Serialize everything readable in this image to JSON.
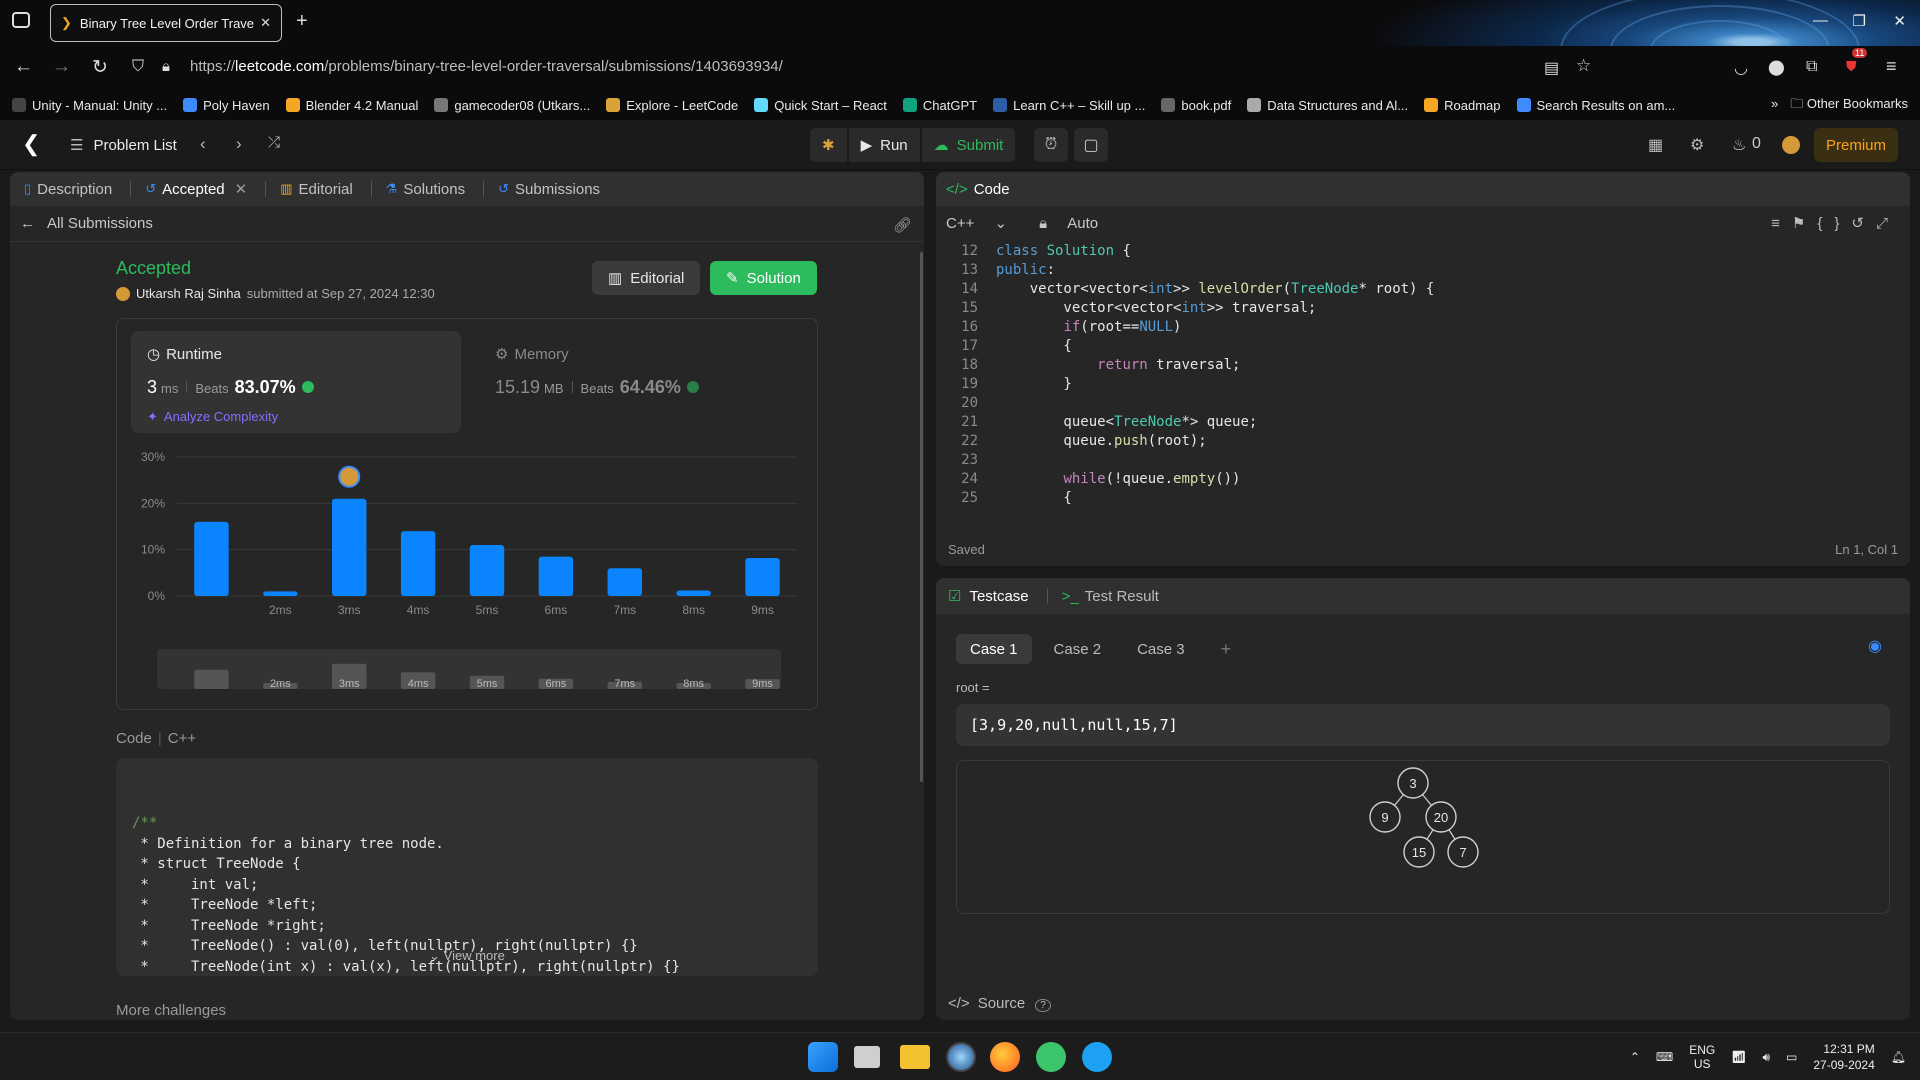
{
  "browser": {
    "tab_title": "Binary Tree Level Order Traver",
    "url_prefix": "https://",
    "url_domain": "leetcode.com",
    "url_path": "/problems/binary-tree-level-order-traversal/submissions/1403693934/",
    "bookmarks": [
      "Unity - Manual: Unity ...",
      "Poly Haven",
      "Blender 4.2 Manual",
      "gamecoder08 (Utkars...",
      "Explore - LeetCode",
      "Quick Start – React",
      "ChatGPT",
      "Learn C++ – Skill up ...",
      "book.pdf",
      "Data Structures and Al...",
      "Roadmap",
      "Search Results on am..."
    ],
    "other_bookmarks": "Other Bookmarks",
    "ext_badge": "11"
  },
  "topbar": {
    "problem_list": "Problem List",
    "run": "Run",
    "submit": "Submit",
    "streak": "0",
    "premium": "Premium"
  },
  "left": {
    "tabs": [
      "Description",
      "Accepted",
      "Editorial",
      "Solutions",
      "Submissions"
    ],
    "all_submissions": "All Submissions",
    "status": "Accepted",
    "author": "Utkarsh Raj Sinha",
    "submitted": "submitted at Sep 27, 2024 12:30",
    "editorial_btn": "Editorial",
    "solution_btn": "Solution",
    "runtime": {
      "label": "Runtime",
      "value": "3",
      "unit": "ms",
      "beats_label": "Beats",
      "beats": "83.07%"
    },
    "memory": {
      "label": "Memory",
      "value": "15.19",
      "unit": "MB",
      "beats_label": "Beats",
      "beats": "64.46%"
    },
    "analyze": "Analyze Complexity",
    "code_label": "Code",
    "code_lang": "C++",
    "code_lines": [
      "/**",
      " * Definition for a binary tree node.",
      " * struct TreeNode {",
      " *     int val;",
      " *     TreeNode *left;",
      " *     TreeNode *right;",
      " *     TreeNode() : val(0), left(nullptr), right(nullptr) {}",
      " *     TreeNode(int x) : val(x), left(nullptr), right(nullptr) {}"
    ],
    "view_more": "View more",
    "more_challenges": "More challenges"
  },
  "chart_data": {
    "type": "bar",
    "yticks": [
      "30%",
      "20%",
      "10%",
      "0%"
    ],
    "ylim": [
      0,
      30
    ],
    "categories": [
      "",
      "2ms",
      "3ms",
      "4ms",
      "5ms",
      "6ms",
      "7ms",
      "8ms",
      "9ms"
    ],
    "values": [
      16,
      1,
      21,
      14,
      11,
      8.5,
      6,
      1.2,
      8.2
    ],
    "highlight_index": 2,
    "colors": {
      "bar": "#0a84ff",
      "grid": "#3a3a3a"
    },
    "minimap_labels": [
      "2ms",
      "3ms",
      "4ms",
      "5ms",
      "6ms",
      "7ms",
      "8ms",
      "9ms"
    ]
  },
  "code": {
    "header": "Code",
    "lang": "C++",
    "mode": "Auto",
    "saved": "Saved",
    "cursor": "Ln 1, Col 1",
    "lines": [
      {
        "n": "12",
        "t": "class Solution {"
      },
      {
        "n": "13",
        "t": "public:"
      },
      {
        "n": "14",
        "t": "    vector<vector<int>> levelOrder(TreeNode* root) {"
      },
      {
        "n": "15",
        "t": "        vector<vector<int>> traversal;"
      },
      {
        "n": "16",
        "t": "        if(root==NULL)"
      },
      {
        "n": "17",
        "t": "        {"
      },
      {
        "n": "18",
        "t": "            return traversal;"
      },
      {
        "n": "19",
        "t": "        }"
      },
      {
        "n": "20",
        "t": ""
      },
      {
        "n": "21",
        "t": "        queue<TreeNode*> queue;"
      },
      {
        "n": "22",
        "t": "        queue.push(root);"
      },
      {
        "n": "23",
        "t": ""
      },
      {
        "n": "24",
        "t": "        while(!queue.empty())"
      },
      {
        "n": "25",
        "t": "        {"
      }
    ]
  },
  "testcase": {
    "tab": "Testcase",
    "result_tab": "Test Result",
    "cases": [
      "Case 1",
      "Case 2",
      "Case 3"
    ],
    "param": "root =",
    "value": "[3,9,20,null,null,15,7]",
    "tree_nodes": [
      "3",
      "9",
      "20",
      "15",
      "7"
    ],
    "source": "Source"
  },
  "taskbar": {
    "lang1": "ENG",
    "lang2": "US",
    "time": "12:31 PM",
    "date": "27-09-2024"
  }
}
